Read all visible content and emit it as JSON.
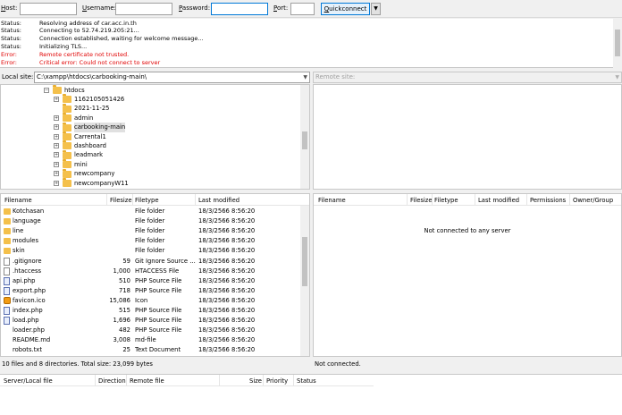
{
  "quickconnect": {
    "host_label": "Host:",
    "user_label": "Username:",
    "pass_label": "Password:",
    "port_label": "Port:",
    "host_value": "",
    "user_value": "",
    "pass_value": "",
    "port_value": "",
    "button_label": "Quickconnect",
    "dropdown_glyph": "▼"
  },
  "log": [
    {
      "type": "Status:",
      "msg": "Resolving address of car.acc.in.th",
      "error": false
    },
    {
      "type": "Status:",
      "msg": "Connecting to 52.74.219.205:21...",
      "error": false
    },
    {
      "type": "Status:",
      "msg": "Connection established, waiting for welcome message...",
      "error": false
    },
    {
      "type": "Status:",
      "msg": "Initializing TLS...",
      "error": false
    },
    {
      "type": "Error:",
      "msg": "Remote certificate not trusted.",
      "error": true
    },
    {
      "type": "Error:",
      "msg": "Critical error: Could not connect to server",
      "error": true
    }
  ],
  "local_site": {
    "label": "Local site:",
    "path": "C:\\xampp\\htdocs\\carbooking-main\\",
    "dropdown_glyph": "▼"
  },
  "remote_site": {
    "label": "Remote site:",
    "path": "",
    "dropdown_glyph": "▼"
  },
  "tree": [
    {
      "name": "htdocs",
      "expander": "−",
      "level": 0,
      "selected": false
    },
    {
      "name": "1162105051426",
      "expander": "+",
      "level": 1,
      "selected": false
    },
    {
      "name": "2021-11-25",
      "expander": "",
      "level": 1,
      "selected": false
    },
    {
      "name": "admin",
      "expander": "+",
      "level": 1,
      "selected": false
    },
    {
      "name": "carbooking-main",
      "expander": "+",
      "level": 1,
      "selected": true
    },
    {
      "name": "Carrental1",
      "expander": "+",
      "level": 1,
      "selected": false
    },
    {
      "name": "dashboard",
      "expander": "+",
      "level": 1,
      "selected": false
    },
    {
      "name": "leadmark",
      "expander": "+",
      "level": 1,
      "selected": false
    },
    {
      "name": "mini",
      "expander": "+",
      "level": 1,
      "selected": false
    },
    {
      "name": "newcompany",
      "expander": "+",
      "level": 1,
      "selected": false
    },
    {
      "name": "newcompanyW11",
      "expander": "+",
      "level": 1,
      "selected": false
    }
  ],
  "local_list": {
    "headers": [
      "Filename",
      "Filesize",
      "Filetype",
      "Last modified"
    ],
    "rows": [
      {
        "name": "Kotchasan",
        "size": "",
        "type": "File folder",
        "modified": "18/3/2566 8:56:20",
        "icon": "folder"
      },
      {
        "name": "language",
        "size": "",
        "type": "File folder",
        "modified": "18/3/2566 8:56:20",
        "icon": "folder"
      },
      {
        "name": "line",
        "size": "",
        "type": "File folder",
        "modified": "18/3/2566 8:56:20",
        "icon": "folder"
      },
      {
        "name": "modules",
        "size": "",
        "type": "File folder",
        "modified": "18/3/2566 8:56:20",
        "icon": "folder"
      },
      {
        "name": "skin",
        "size": "",
        "type": "File folder",
        "modified": "18/3/2566 8:56:20",
        "icon": "folder"
      },
      {
        "name": ".gitignore",
        "size": "59",
        "type": "Git Ignore Source ...",
        "modified": "18/3/2566 8:56:20",
        "icon": "file"
      },
      {
        "name": ".htaccess",
        "size": "1,000",
        "type": "HTACCESS File",
        "modified": "18/3/2566 8:56:20",
        "icon": "file"
      },
      {
        "name": "api.php",
        "size": "510",
        "type": "PHP Source File",
        "modified": "18/3/2566 8:56:20",
        "icon": "php"
      },
      {
        "name": "export.php",
        "size": "718",
        "type": "PHP Source File",
        "modified": "18/3/2566 8:56:20",
        "icon": "php"
      },
      {
        "name": "favicon.ico",
        "size": "15,086",
        "type": "Icon",
        "modified": "18/3/2566 8:56:20",
        "icon": "ico"
      },
      {
        "name": "index.php",
        "size": "515",
        "type": "PHP Source File",
        "modified": "18/3/2566 8:56:20",
        "icon": "php"
      },
      {
        "name": "load.php",
        "size": "1,696",
        "type": "PHP Source File",
        "modified": "18/3/2566 8:56:20",
        "icon": "php"
      },
      {
        "name": "loader.php",
        "size": "482",
        "type": "PHP Source File",
        "modified": "18/3/2566 8:56:20",
        "icon": "none"
      },
      {
        "name": "README.md",
        "size": "3,008",
        "type": "md-file",
        "modified": "18/3/2566 8:56:20",
        "icon": "none"
      },
      {
        "name": "robots.txt",
        "size": "25",
        "type": "Text Document",
        "modified": "18/3/2566 8:56:20",
        "icon": "none"
      }
    ]
  },
  "remote_list": {
    "headers": [
      "Filename",
      "Filesize",
      "Filetype",
      "Last modified",
      "Permissions",
      "Owner/Group"
    ],
    "placeholder": "Not connected to any server"
  },
  "local_status": "10 files and 8 directories. Total size: 23,099 bytes",
  "remote_status": "Not connected.",
  "queue": {
    "headers": [
      "Server/Local file",
      "Direction",
      "Remote file",
      "Size",
      "Priority",
      "Status"
    ]
  }
}
